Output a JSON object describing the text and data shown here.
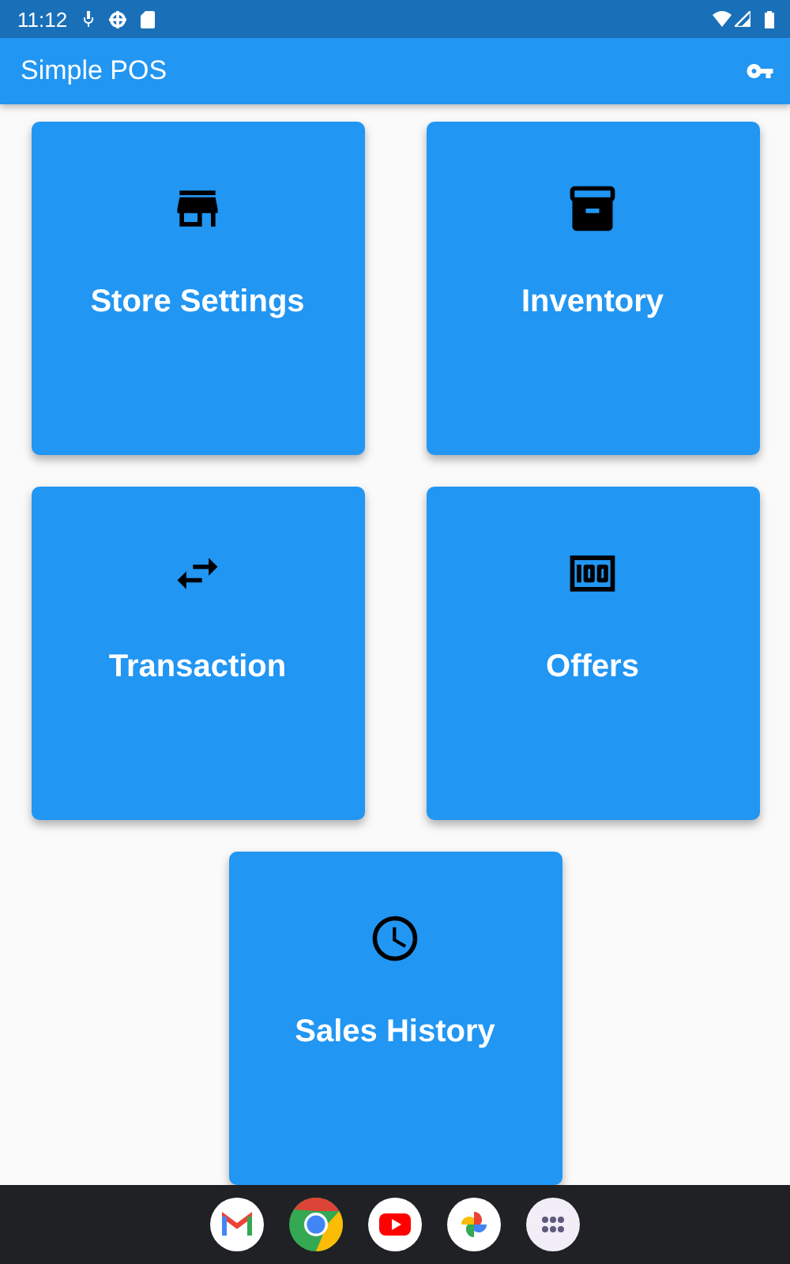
{
  "status_bar": {
    "time": "11:12"
  },
  "app_bar": {
    "title": "Simple POS"
  },
  "tiles": [
    {
      "label": "Store Settings"
    },
    {
      "label": "Inventory"
    },
    {
      "label": "Transaction"
    },
    {
      "label": "Offers"
    },
    {
      "label": "Sales History"
    }
  ]
}
